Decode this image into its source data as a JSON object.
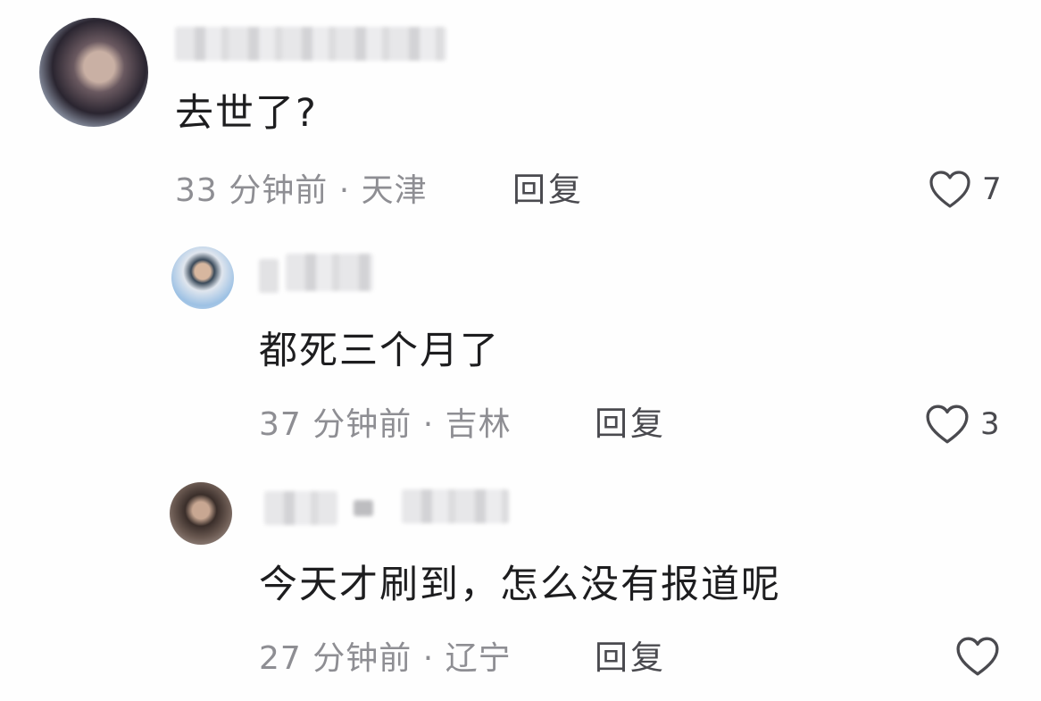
{
  "comments": [
    {
      "content": "去世了?",
      "time": "33 分钟前",
      "separator": "·",
      "location": "天津",
      "reply_label": "回复",
      "like_count": "7"
    },
    {
      "content": "都死三个月了",
      "time": "37 分钟前",
      "separator": "·",
      "location": "吉林",
      "reply_label": "回复",
      "like_count": "3"
    },
    {
      "content": "今天才刷到，怎么没有报道呢",
      "time": "27 分钟前",
      "separator": "·",
      "location": "辽宁",
      "reply_label": "回复",
      "like_count": ""
    }
  ],
  "icons": {
    "like": "heart-outline-icon"
  },
  "colors": {
    "text": "#1d1d1f",
    "meta": "#8e8e93",
    "icon": "#4a4a4f"
  }
}
